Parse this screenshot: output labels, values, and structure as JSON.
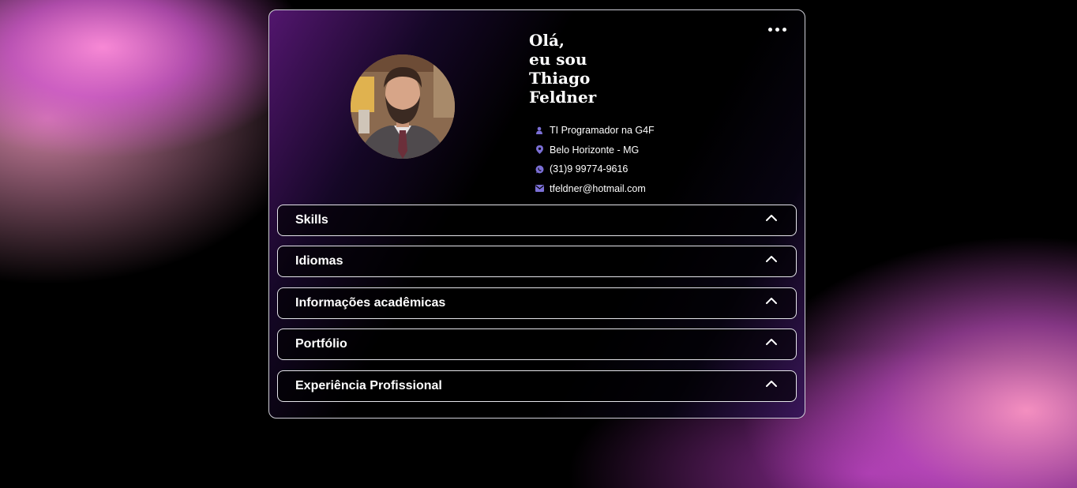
{
  "profile": {
    "greeting_line1": "Olá,",
    "greeting_line2": "eu sou",
    "first_name": "Thiago",
    "last_name": "Feldner",
    "info": [
      {
        "icon": "user-icon",
        "text": "TI Programador na G4F"
      },
      {
        "icon": "location-pin-icon",
        "text": "Belo Horizonte - MG"
      },
      {
        "icon": "whatsapp-icon",
        "text": "(31)9 99774-9616"
      },
      {
        "icon": "envelope-icon",
        "text": "tfeldner@hotmail.com"
      }
    ]
  },
  "sections": [
    {
      "label": "Skills"
    },
    {
      "label": "Idiomas"
    },
    {
      "label": "Informações acadêmicas"
    },
    {
      "label": "Portfólio"
    },
    {
      "label": "Experiência Profissional"
    }
  ],
  "colors": {
    "accent": "#7b6fd6",
    "card_border": "#d0d0d8",
    "pink": "#f08cd0",
    "purple": "#a040c8"
  }
}
